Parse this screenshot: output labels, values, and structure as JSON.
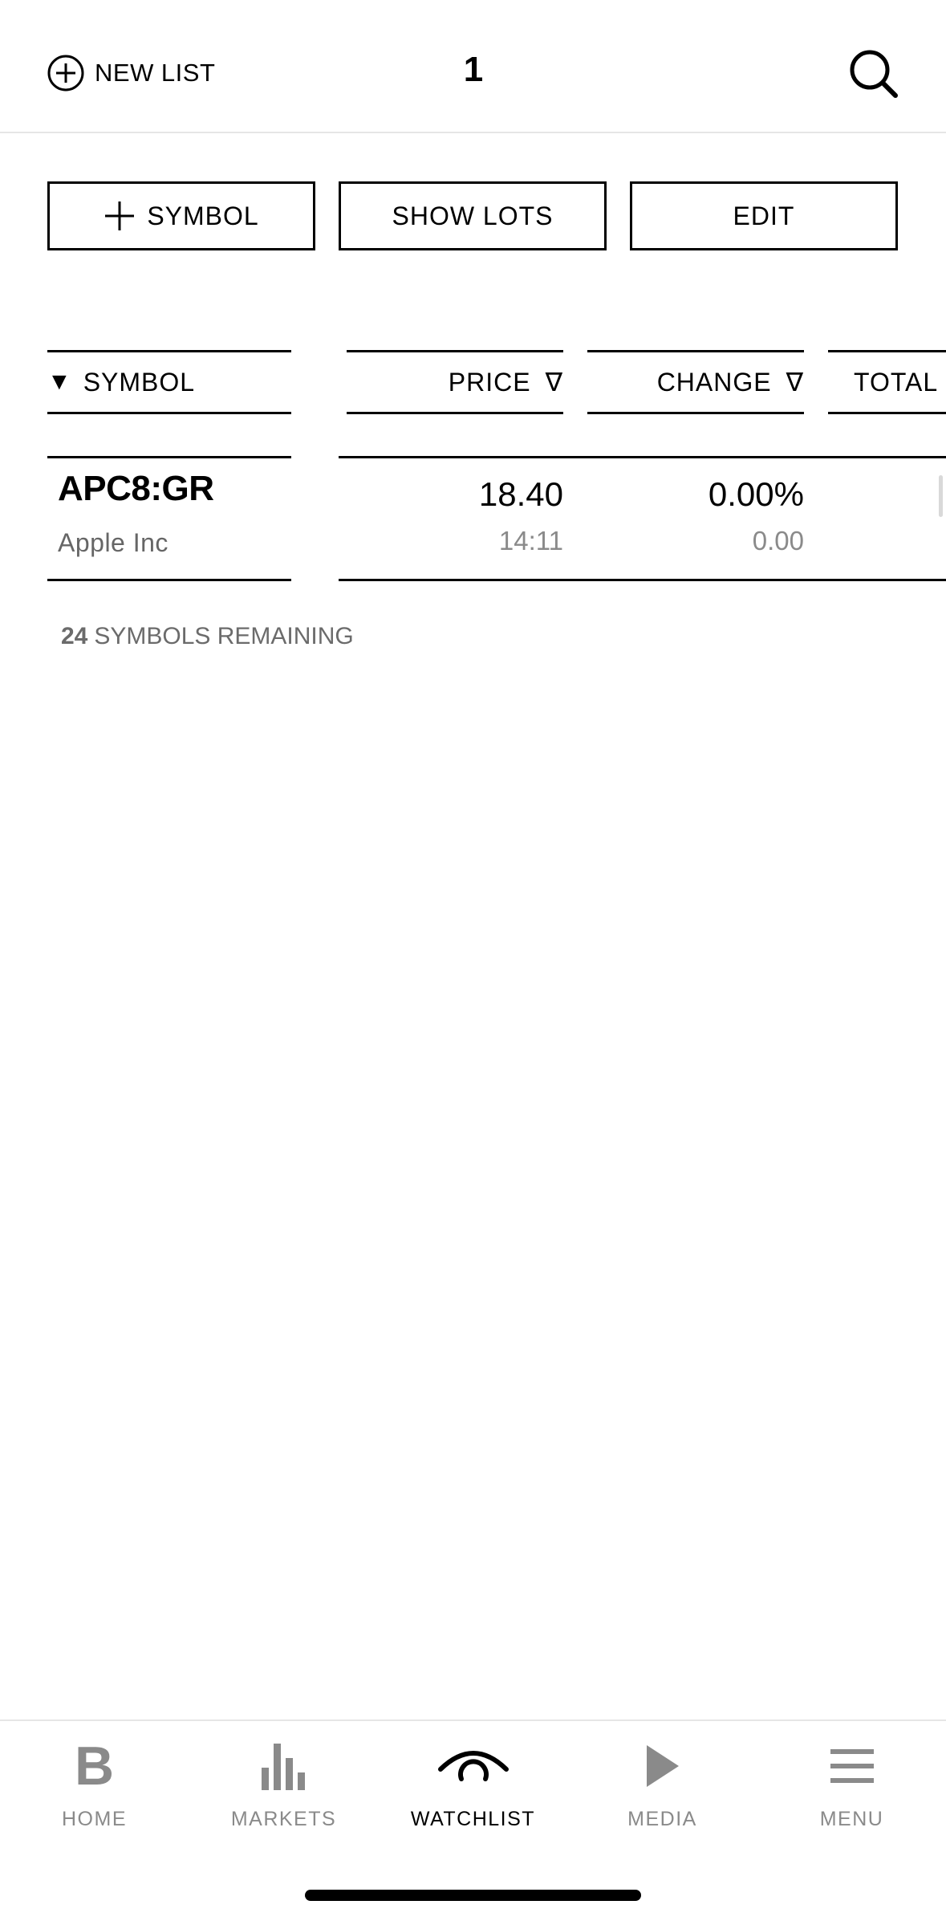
{
  "header": {
    "new_list_label": "NEW LIST",
    "list_title": "1",
    "icons": {
      "new_list": "plus-circle-icon",
      "search": "search-icon"
    }
  },
  "actions": {
    "add_symbol_label": "SYMBOL",
    "show_lots_label": "SHOW LOTS",
    "edit_label": "EDIT"
  },
  "columns": {
    "symbol": {
      "label": "SYMBOL",
      "sort_icon": "▼"
    },
    "price": {
      "label": "PRICE",
      "sort_icon": "∇"
    },
    "change": {
      "label": "CHANGE",
      "sort_icon": "∇"
    },
    "total": {
      "label": "TOTAL"
    }
  },
  "rows": [
    {
      "ticker": "APC8:GR",
      "company": "Apple Inc",
      "price": "18.40",
      "time": "14:11",
      "change_pct": "0.00%",
      "change": "0.00"
    }
  ],
  "remaining": {
    "count": "24",
    "label": "SYMBOLS REMAINING"
  },
  "nav": {
    "items": [
      {
        "label": "HOME",
        "icon": "bloomberg-b-icon",
        "icon_text": "B"
      },
      {
        "label": "MARKETS",
        "icon": "bar-chart-icon"
      },
      {
        "label": "WATCHLIST",
        "icon": "eye-icon",
        "active": true
      },
      {
        "label": "MEDIA",
        "icon": "play-icon"
      },
      {
        "label": "MENU",
        "icon": "hamburger-icon"
      }
    ]
  },
  "colors": {
    "text": "#000000",
    "muted": "#8a8a8a",
    "divider": "#e6e6e6",
    "background": "#ffffff"
  }
}
